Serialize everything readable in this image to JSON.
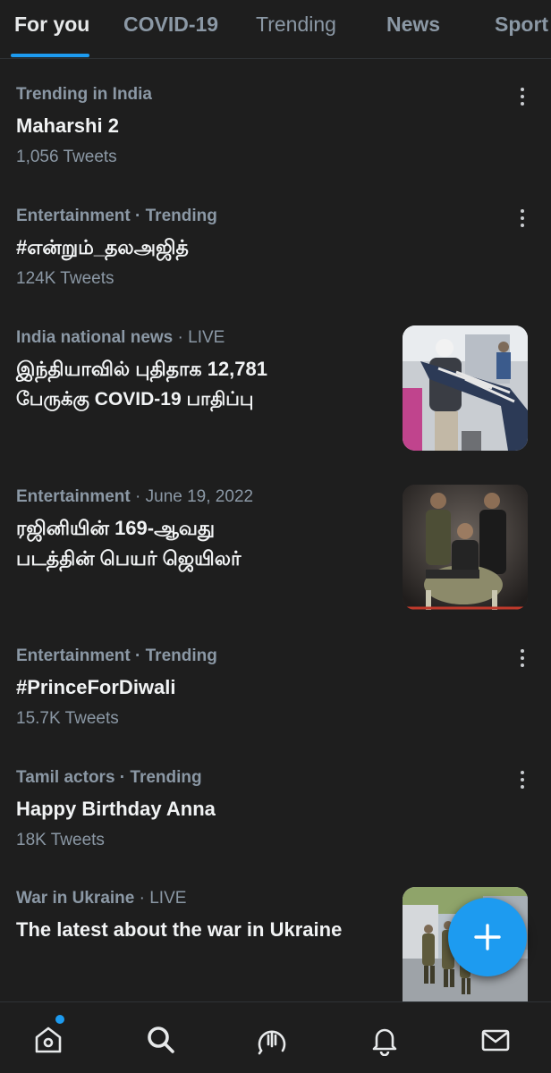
{
  "tabs": [
    {
      "label": "For you"
    },
    {
      "label": "COVID-19"
    },
    {
      "label": "Trending"
    },
    {
      "label": "News"
    },
    {
      "label": "Sport"
    }
  ],
  "trends": [
    {
      "context": "Trending in India",
      "title": "Maharshi 2",
      "count": "1,056 Tweets"
    },
    {
      "context": "Entertainment · Trending",
      "title": "#என்றும்_தலஅஜித்",
      "count": "124K Tweets"
    },
    {
      "context": "India national news",
      "context_extra": " · LIVE",
      "title_line1": "இந்தியாவில் புதிதாக 12,781",
      "title_line2": "பேருக்கு COVID-19 பாதிப்பு",
      "thumb_icon": "crowd-photo"
    },
    {
      "context": "Entertainment",
      "context_extra": " · June 19, 2022",
      "title_line1": "ரஜினியின் 169-ஆவது",
      "title_line2": "படத்தின் பெயர் ஜெயிலர்",
      "thumb_icon": "movie-poster-photo"
    },
    {
      "context": "Entertainment · Trending",
      "title": "#PrinceForDiwali",
      "count": "15.7K Tweets"
    },
    {
      "context": "Tamil actors · Trending",
      "title": "Happy Birthday Anna",
      "count": "18K Tweets"
    },
    {
      "context": "War in Ukraine",
      "context_extra": " · LIVE",
      "title": "The latest about the war in Ukraine",
      "thumb_icon": "soldiers-photo"
    }
  ],
  "fab": {
    "icon": "plus-icon"
  },
  "nav": {
    "icons": [
      "home-icon",
      "search-icon",
      "spaces-icon",
      "notifications-icon",
      "messages-icon"
    ]
  },
  "colors": {
    "accent": "#1d9bf0",
    "background": "#1e1e1e",
    "secondary_text": "#8b98a5"
  }
}
